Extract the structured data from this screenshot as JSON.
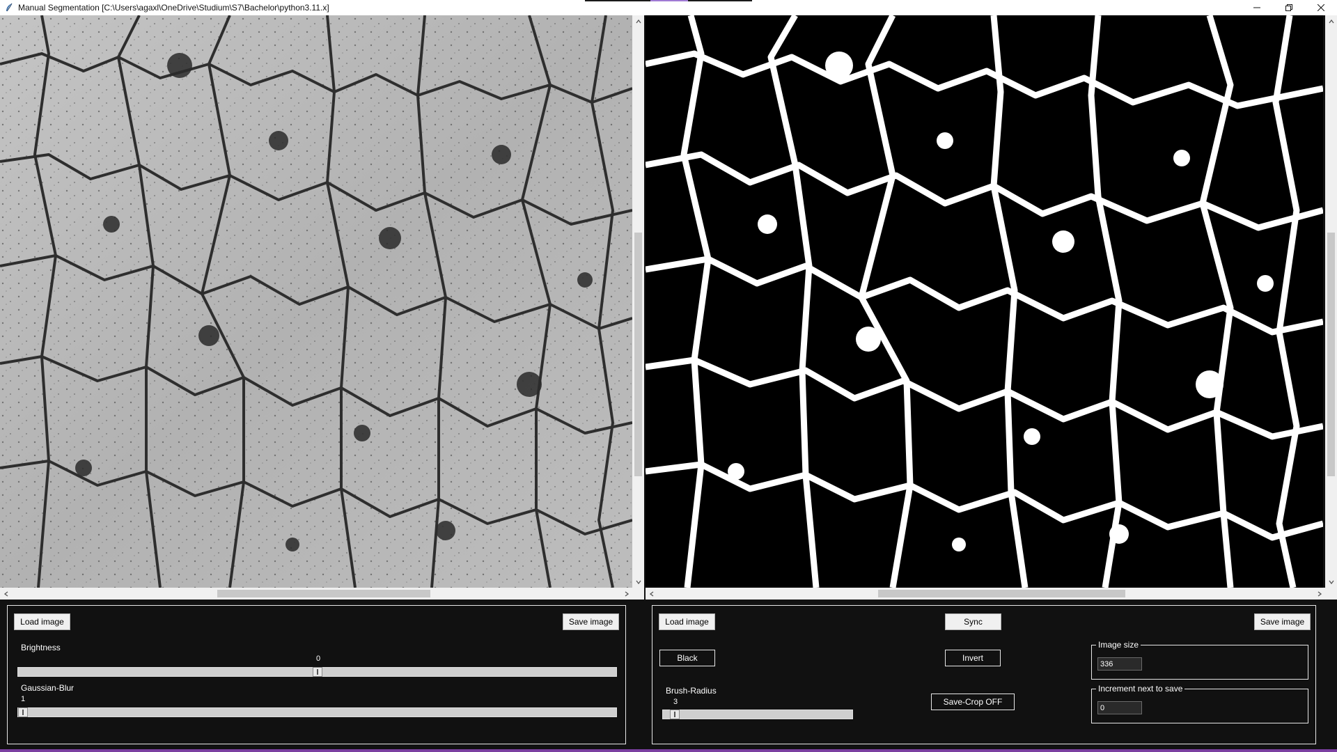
{
  "window": {
    "title": "Manual Segmentation [C:\\Users\\agaxl\\OneDrive\\Studium\\S7\\Bachelor\\python3.11.x]",
    "minimize_icon": "minimize-icon",
    "maximize_icon": "restore-icon",
    "close_icon": "close-icon"
  },
  "left_view": {
    "image_description_icon": "micrograph-grayscale",
    "v_scroll_fraction": 0.38,
    "h_scroll_fraction": 0.34
  },
  "right_view": {
    "image_description_icon": "segmentation-mask",
    "v_scroll_fraction": 0.38,
    "h_scroll_fraction": 0.34
  },
  "left_panel": {
    "load_label": "Load image",
    "save_label": "Save image",
    "brightness_label": "Brightness",
    "brightness_value": "0",
    "brightness_fraction": 0.5,
    "blur_label": "Gaussian-Blur",
    "blur_value": "1",
    "blur_fraction": 0.0
  },
  "right_panel": {
    "load_label": "Load image",
    "sync_label": "Sync",
    "save_label": "Save image",
    "black_label": "Black",
    "invert_label": "Invert",
    "brush_label": "Brush-Radius",
    "brush_value": "3",
    "brush_fraction": 0.05,
    "savecrop_label": "Save-Crop OFF",
    "image_size_label": "Image size",
    "image_size_value": "336",
    "increment_label": "Increment next to save",
    "increment_value": "0"
  },
  "colors": {
    "background": "#111111",
    "panel_border": "#e8e8e8",
    "button_light": "#f0f0f0",
    "accent": "#7a3fa0"
  }
}
